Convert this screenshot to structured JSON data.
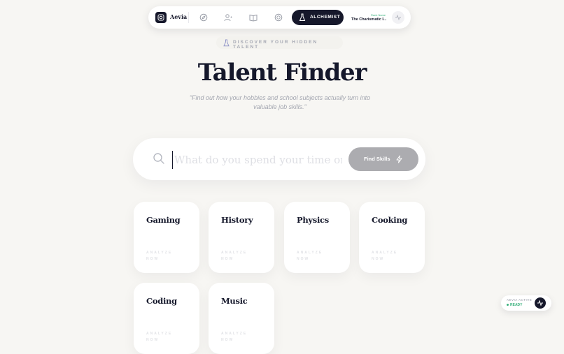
{
  "nav": {
    "brand": "Aevia",
    "icons": [
      "compass-icon",
      "user-icon",
      "book-icon",
      "globe-icon"
    ],
    "active_tab": "ALCHEMIST",
    "rank_label": "Rank Name",
    "rank_value": "The Charismatic I..."
  },
  "hero": {
    "tagline": "DISCOVER YOUR HIDDEN TALENT",
    "title": "Talent Finder",
    "subtitle": "\"Find out how your hobbies and school subjects actually turn into valuable job skills.\""
  },
  "search": {
    "placeholder": "What do you spend your time on?",
    "button_label": "Find Skills"
  },
  "cards": [
    {
      "title": "Gaming",
      "action": "ANALYZE NOW"
    },
    {
      "title": "History",
      "action": "ANALYZE NOW"
    },
    {
      "title": "Physics",
      "action": "ANALYZE NOW"
    },
    {
      "title": "Cooking",
      "action": "ANALYZE NOW"
    },
    {
      "title": "Coding",
      "action": "ANALYZE NOW"
    },
    {
      "title": "Music",
      "action": "ANALYZE NOW"
    }
  ],
  "status": {
    "label": "AEVIA ACTIVE",
    "state": "READY"
  },
  "colors": {
    "dark": "#16182b",
    "accent_green": "#3cb27e",
    "background": "#f7f6f3"
  }
}
